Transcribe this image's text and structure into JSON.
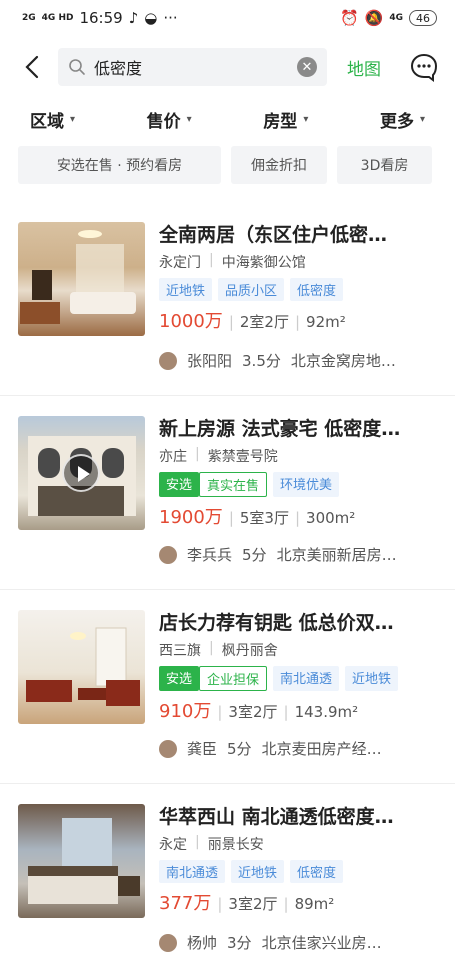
{
  "status_bar": {
    "signal1": "2G",
    "signal2": "4G HD",
    "time": "16:59",
    "dots": "···",
    "lte": "4G",
    "battery": "46"
  },
  "search": {
    "query": "低密度",
    "map_label": "地图"
  },
  "filters": [
    {
      "label": "区域"
    },
    {
      "label": "售价"
    },
    {
      "label": "房型"
    },
    {
      "label": "更多"
    }
  ],
  "chips": [
    {
      "label": "安选在售 · 预约看房"
    },
    {
      "label": "佣金折扣"
    },
    {
      "label": "3D看房"
    }
  ],
  "listings": [
    {
      "title": "全南两居（东区住户低密…",
      "area": "永定门",
      "community": "中海紫御公馆",
      "tags": [
        "近地铁",
        "品质小区",
        "低密度"
      ],
      "price": "1000万",
      "layout": "2室2厅",
      "size": "92m²",
      "agent": "张阳阳",
      "score": "3.5分",
      "agency": "北京金窝房地…"
    },
    {
      "title": "新上房源 法式豪宅 低密度…",
      "area": "亦庄",
      "community": "紫禁壹号院",
      "badge": "安选",
      "badge_tag": "真实在售",
      "tags": [
        "环境优美"
      ],
      "price": "1900万",
      "layout": "5室3厅",
      "size": "300m²",
      "agent": "李兵兵",
      "score": "5分",
      "agency": "北京美丽新居房…"
    },
    {
      "title": "店长力荐有钥匙 低总价双…",
      "area": "西三旗",
      "community": "枫丹丽舍",
      "badge": "安选",
      "badge_tag": "企业担保",
      "tags": [
        "南北通透",
        "近地铁"
      ],
      "price": "910万",
      "layout": "3室2厅",
      "size": "143.9m²",
      "agent": "龚臣",
      "score": "5分",
      "agency": "北京麦田房产经纪…"
    },
    {
      "title": "华萃西山 南北通透低密度…",
      "area": "永定",
      "community": "丽景长安",
      "tags": [
        "南北通透",
        "近地铁",
        "低密度"
      ],
      "price": "377万",
      "layout": "3室2厅",
      "size": "89m²",
      "agent": "杨帅",
      "score": "3分",
      "agency": "北京佳家兴业房地…"
    }
  ],
  "colors": {
    "accent_green": "#2cb34a",
    "price_red": "#e34a33",
    "tag_blue": "#4a8bd8"
  }
}
